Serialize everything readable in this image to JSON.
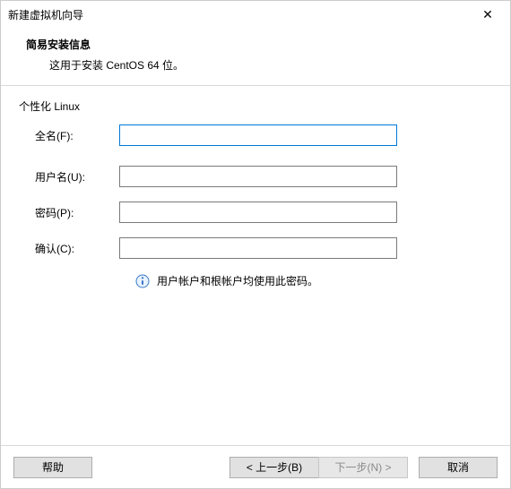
{
  "window": {
    "title": "新建虚拟机向导",
    "close_glyph": "✕"
  },
  "header": {
    "title": "简易安装信息",
    "subtitle": "这用于安装 CentOS 64 位。"
  },
  "section": {
    "title": "个性化 Linux"
  },
  "form": {
    "fullname": {
      "label": "全名(F):",
      "value": ""
    },
    "username": {
      "label": "用户名(U):",
      "value": ""
    },
    "password": {
      "label": "密码(P):",
      "value": ""
    },
    "confirm": {
      "label": "确认(C):",
      "value": ""
    }
  },
  "info": {
    "text": "用户帐户和根帐户均使用此密码。"
  },
  "footer": {
    "help": "帮助",
    "back": "< 上一步(B)",
    "next": "下一步(N) >",
    "cancel": "取消"
  }
}
